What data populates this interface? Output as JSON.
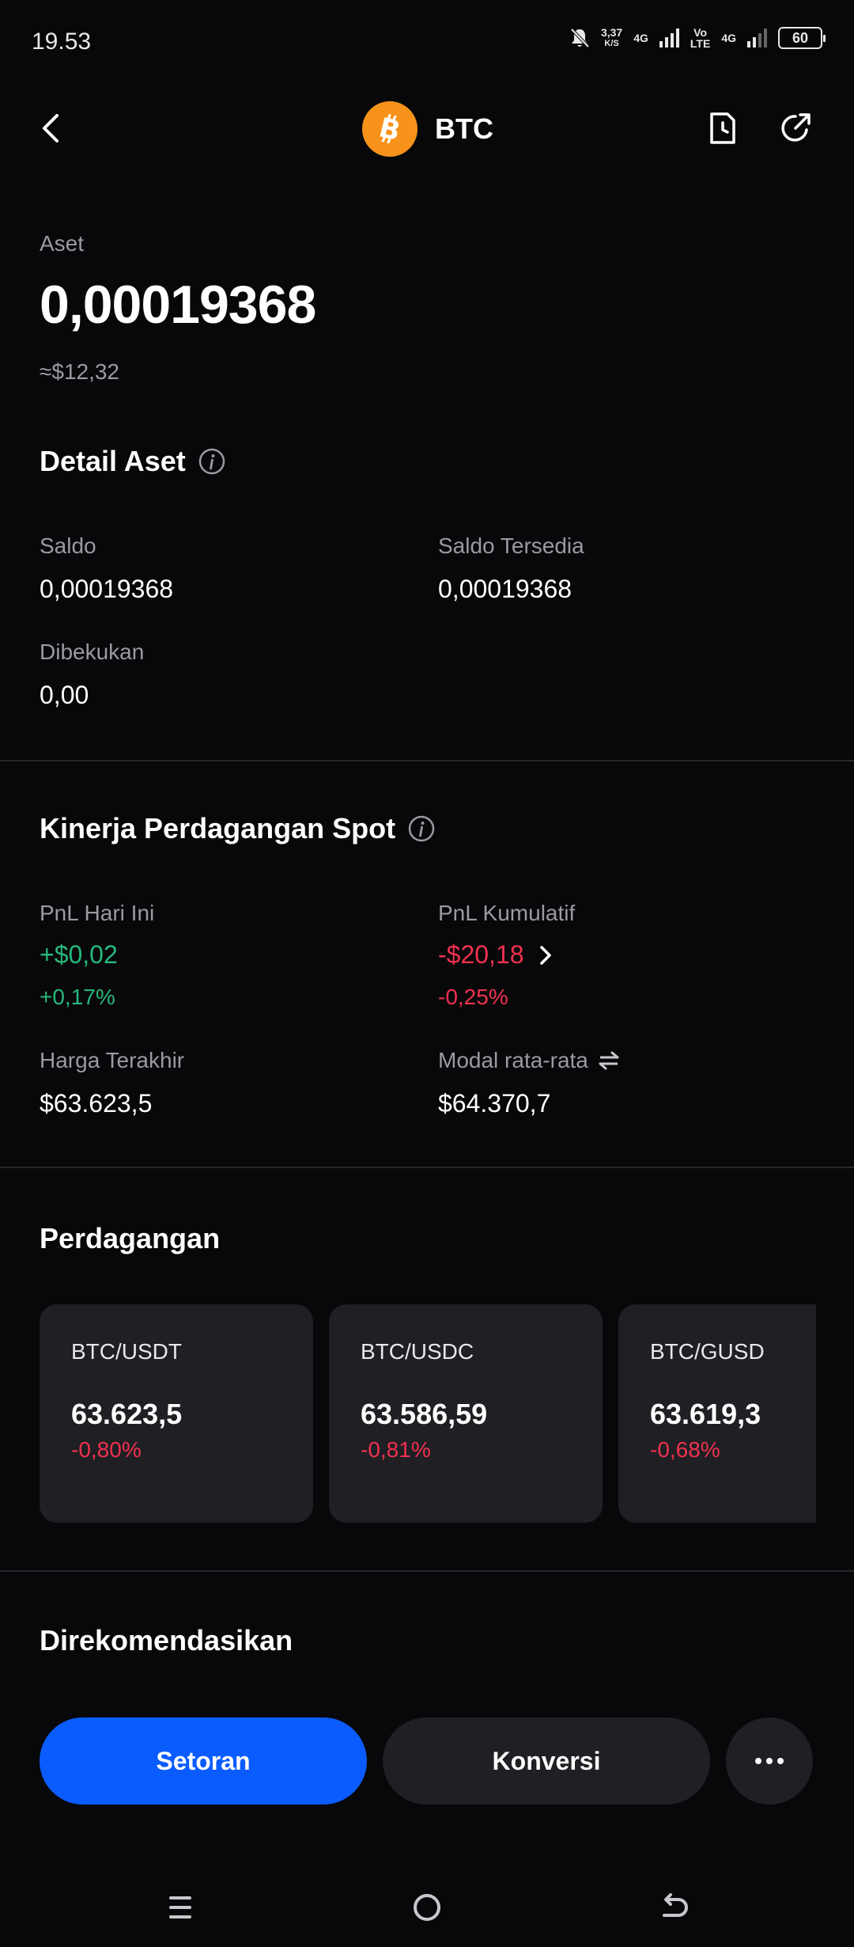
{
  "status_bar": {
    "time": "19.53",
    "net_speed": "3,37",
    "net_unit": "K/S",
    "net1": "4G",
    "volte": "Vo",
    "volte2": "LTE",
    "net2": "4G",
    "battery": "60"
  },
  "header": {
    "title": "BTC",
    "logo_color": "#f7931a"
  },
  "asset": {
    "label": "Aset",
    "value": "0,00019368",
    "approx": "≈$12,32"
  },
  "detail": {
    "title": "Detail Aset",
    "saldo_label": "Saldo",
    "saldo_value": "0,00019368",
    "tersedia_label": "Saldo Tersedia",
    "tersedia_value": "0,00019368",
    "beku_label": "Dibekukan",
    "beku_value": "0,00"
  },
  "performance": {
    "title": "Kinerja Perdagangan Spot",
    "pnl_today_label": "PnL Hari Ini",
    "pnl_today_value": "+$0,02",
    "pnl_today_pct": "+0,17%",
    "pnl_cum_label": "PnL Kumulatif",
    "pnl_cum_value": "-$20,18",
    "pnl_cum_pct": "-0,25%",
    "last_price_label": "Harga Terakhir",
    "last_price_value": "$63.623,5",
    "avg_cost_label": "Modal rata-rata",
    "avg_cost_value": "$64.370,7",
    "colors": {
      "positive": "#27b87a",
      "negative": "#f0314f"
    }
  },
  "trading": {
    "title": "Perdagangan",
    "cards": [
      {
        "pair": "BTC/USDT",
        "price": "63.623,5",
        "change": "-0,80%"
      },
      {
        "pair": "BTC/USDC",
        "price": "63.586,59",
        "change": "-0,81%"
      },
      {
        "pair": "BTC/GUSD",
        "price": "63.619,3",
        "change": "-0,68%"
      }
    ]
  },
  "recommended": {
    "title": "Direkomendasikan"
  },
  "actions": {
    "deposit": "Setoran",
    "convert": "Konversi",
    "more": "···",
    "primary_color": "#0a5cff"
  }
}
